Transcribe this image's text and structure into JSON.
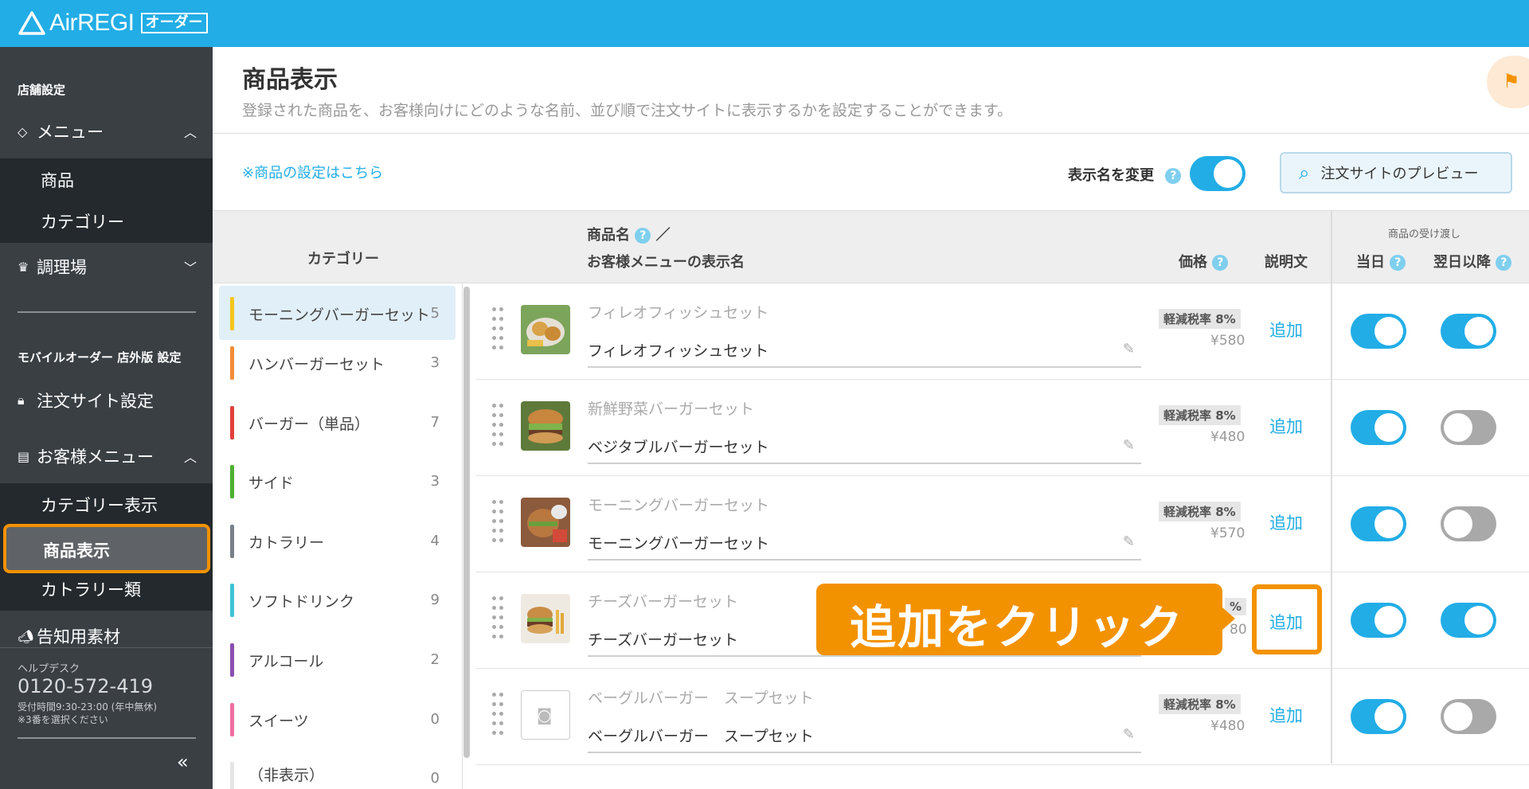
{
  "app": {
    "logo_text": "AirREGI",
    "logo_badge": "オーダー",
    "colors": {
      "brand": "#22ade6",
      "highlight": "#f39200",
      "sidebar": "#3a3f44"
    }
  },
  "sidebar": {
    "section_store": "店舗設定",
    "menu": {
      "label": "メニュー",
      "icon": "tag-icon"
    },
    "menu_items": [
      "商品",
      "カテゴリー"
    ],
    "kitchen": {
      "label": "調理場",
      "icon": "chef-hat-icon"
    },
    "section_mobile": "モバイルオーダー 店外版 設定",
    "order_site": {
      "label": "注文サイト設定",
      "icon": "lock-icon"
    },
    "customer_menu": {
      "label": "お客様メニュー",
      "icon": "clipboard-icon"
    },
    "customer_items": [
      "カテゴリー表示",
      "商品表示",
      "カトラリー類"
    ],
    "promo": {
      "label": "告知用素材",
      "icon": "megaphone-icon"
    },
    "help": {
      "title": "ヘルプデスク",
      "phone": "0120-572-419",
      "hours": "受付時間9:30-23:00 (年中無休)",
      "note": "※3番を選択ください"
    },
    "collapse": "«"
  },
  "main": {
    "title": "商品表示",
    "description": "登録された商品を、お客様向けにどのような名前、並び順で注文サイトに表示するかを設定することができます。",
    "settings_link": "※商品の設定はこちら",
    "name_change_label": "表示名を変更",
    "name_change_on": true,
    "preview_button": "注文サイトのプレビュー"
  },
  "table": {
    "col_category": "カテゴリー",
    "col_product_line1": "商品名",
    "col_product_slash": "／",
    "col_product_line2": "お客様メニューの表示名",
    "col_price": "価格",
    "col_description": "説明文",
    "col_delivery_group": "商品の受け渡し",
    "col_sameday": "当日",
    "col_nextday": "翌日以降"
  },
  "categories": [
    {
      "name": "モーニングバーガーセット",
      "count": "5",
      "color": "#f5c518",
      "selected": true
    },
    {
      "name": "ハンバーガーセット",
      "count": "3",
      "color": "#f28c38"
    },
    {
      "name": "バーガー（単品）",
      "count": "7",
      "color": "#e0413a"
    },
    {
      "name": "サイド",
      "count": "3",
      "color": "#4cb030"
    },
    {
      "name": "カトラリー",
      "count": "4",
      "color": "#7a8088"
    },
    {
      "name": "ソフトドリンク",
      "count": "9",
      "color": "#3fc1d6"
    },
    {
      "name": "アルコール",
      "count": "2",
      "color": "#8a4fb0"
    },
    {
      "name": "スイーツ",
      "count": "0",
      "color": "#ef6ea0"
    },
    {
      "name": "（非表示）",
      "count": "0",
      "color": "#dddddd"
    }
  ],
  "products": [
    {
      "name": "フィレオフィッシュセット",
      "display": "フィレオフィッシュセット",
      "tax": "軽減税率 8%",
      "price": "¥580",
      "add": "追加",
      "sameday": true,
      "nextday": true,
      "image": "fish-burger-photo"
    },
    {
      "name": "新鮮野菜バーガーセット",
      "display": "ベジタブルバーガーセット",
      "tax": "軽減税率 8%",
      "price": "¥480",
      "add": "追加",
      "sameday": true,
      "nextday": false,
      "image": "veggie-burger-photo"
    },
    {
      "name": "モーニングバーガーセット",
      "display": "モーニングバーガーセット",
      "tax": "軽減税率 8%",
      "price": "¥570",
      "add": "追加",
      "sameday": true,
      "nextday": false,
      "image": "morning-burger-photo"
    },
    {
      "name": "チーズバーガーセット",
      "display": "チーズバーガーセット",
      "tax": "%",
      "price": "80",
      "add": "追加",
      "sameday": true,
      "nextday": true,
      "image": "cheese-burger-photo"
    },
    {
      "name": "ベーグルバーガー　スープセット",
      "display": "ベーグルバーガー　スープセット",
      "tax": "軽減税率 8%",
      "price": "¥480",
      "add": "追加",
      "sameday": true,
      "nextday": false,
      "image": "camera-icon"
    }
  ],
  "callout": {
    "text": "追加をクリック",
    "target_label": "追加"
  }
}
